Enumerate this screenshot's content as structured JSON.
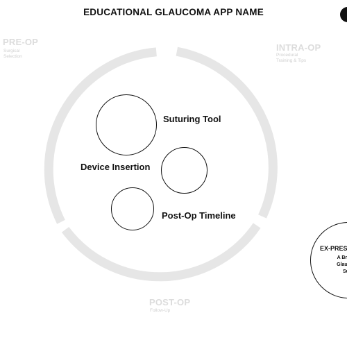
{
  "header": {
    "title": "EDUCATIONAL GLAUCOMA APP NAME"
  },
  "phases": {
    "pre_op": {
      "title": "PRE-OP",
      "subtitle_lines": [
        "Surgical",
        "Selection"
      ]
    },
    "intra_op": {
      "title": "INTRA-OP",
      "subtitle_lines": [
        "Procedural",
        "Training & Tips"
      ]
    },
    "post_op": {
      "title": "POST-OP",
      "subtitle_lines": [
        "Follow-Up"
      ]
    }
  },
  "modules": {
    "suturing_tool": "Suturing Tool",
    "device_insertion": "Device Insertion",
    "post_op_timeline": "Post-Op Timeline"
  },
  "feature": {
    "title": "EX-PRES",
    "lines": [
      "A Breakth",
      "Glaucoma",
      "Surg"
    ]
  },
  "colors": {
    "ring": "#e6e6e6",
    "phase_text": "#dcdcdc",
    "ink": "#111111"
  }
}
